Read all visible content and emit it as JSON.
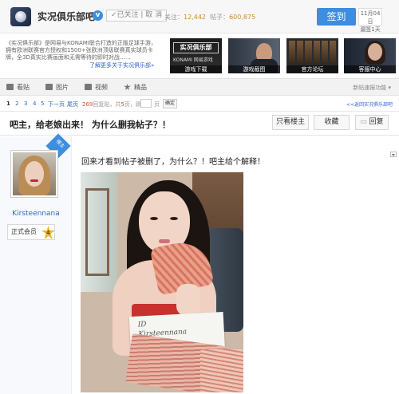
{
  "header": {
    "bar_name": "实况俱乐部吧",
    "follow_label": "✓已关注 | 取 消",
    "stats_prefix": "关注：",
    "followers": "12,442",
    "posts_prefix": "帖子：",
    "posts": "600,875",
    "sign_label": "签到",
    "date_line1": "11月04日",
    "date_line2": "漏签1天"
  },
  "intro": {
    "text": "《实况俱乐部》是网易与KONAMI联合打造的正版足球手游，拥有欧洲联赛官方授权和1500+张欧洲顶级联赛真实球员卡牌，全3D真实比赛画面和无需等待的即时对战……",
    "link": "了解更多关于实况俱乐部»",
    "thumbs": [
      {
        "caption": "游戏下载",
        "badge": "实况俱乐部",
        "sub": "KONAMI 网易游戏"
      },
      {
        "caption": "游戏截图"
      },
      {
        "caption": "官方论坛"
      },
      {
        "caption": "客服中心"
      }
    ]
  },
  "tabs": [
    {
      "label": "看贴",
      "icon": "post-icon"
    },
    {
      "label": "图片",
      "icon": "image-icon"
    },
    {
      "label": "视频",
      "icon": "video-icon"
    },
    {
      "label": "精品",
      "icon": "star-icon"
    }
  ],
  "tab_right": "新帖速报功能 ▾",
  "pager": {
    "pages": [
      "1",
      "2",
      "3",
      "4",
      "5",
      "下一页",
      "尾页"
    ],
    "reply_count": "269",
    "reply_suffix": "回复贴，共",
    "page_count": "5",
    "page_suffix": "页，跳到",
    "ye": "页",
    "go": "确定",
    "back": "<<返回实况俱乐部吧"
  },
  "thread": {
    "title": "吧主，给老娘出来！ 为什么删我帖子？！",
    "only_owner": "只看楼主",
    "favorite": "收藏",
    "reply": "回复"
  },
  "post": {
    "badge": "楼主",
    "username": "Kirsteennana",
    "rank": "正式会员",
    "rank_level": "4",
    "text": "回来才看到帖子被删了，为什么？！吧主给个解释！",
    "photo_sign": "ID\nKirsteennana"
  },
  "colors": {
    "accent": "#3d8de0",
    "link": "#3366cc",
    "header_bg": "#f7f7f7"
  }
}
